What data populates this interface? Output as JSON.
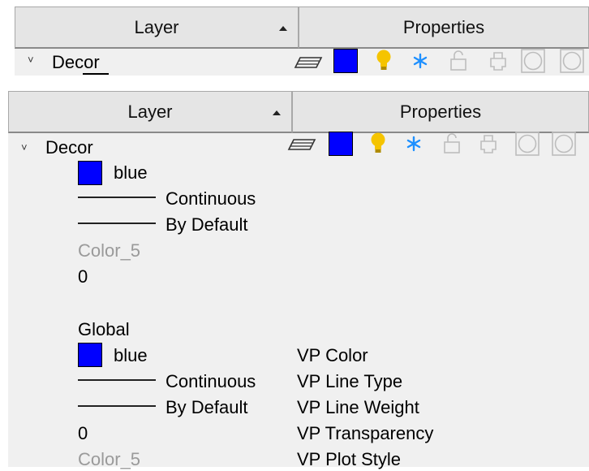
{
  "top_panel": {
    "headers": {
      "layer": "Layer",
      "properties": "Properties"
    },
    "row": {
      "name": "Decor"
    }
  },
  "panel": {
    "headers": {
      "layer": "Layer",
      "properties": "Properties"
    },
    "row": {
      "name": "Decor"
    },
    "details": {
      "color_name": "blue",
      "linetype": "Continuous",
      "lineweight": "By Default",
      "plot_style": "Color_5",
      "transparency": "0"
    },
    "global": {
      "heading": "Global",
      "color_name": "blue",
      "linetype": "Continuous",
      "lineweight": "By Default",
      "transparency": "0",
      "plot_style": "Color_5"
    },
    "vp_labels": {
      "color": "VP Color",
      "linetype": "VP Line Type",
      "lineweight": "VP Line Weight",
      "transparency": "VP Transparency",
      "plot_style": "VP Plot Style"
    }
  },
  "colors": {
    "swatch": "#0000ff",
    "bulb": "#f5c400",
    "freeze": "#1e90ff",
    "header_bg": "#e5e5e5",
    "panel_bg": "#f0f0f0"
  },
  "icons": [
    "layer-plane-icon",
    "color-swatch-icon",
    "lightbulb-icon",
    "freeze-snowflake-icon",
    "lock-icon",
    "plot-icon",
    "circle-icon"
  ]
}
